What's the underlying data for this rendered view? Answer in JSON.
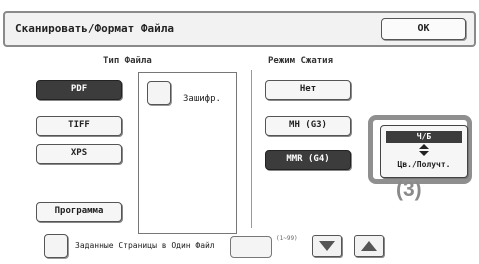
{
  "header": {
    "title": "Сканировать/Формат Файла",
    "ok_label": "OK"
  },
  "file_type": {
    "label": "Тип Файла",
    "options": [
      {
        "label": "PDF",
        "selected": true
      },
      {
        "label": "TIFF",
        "selected": false
      },
      {
        "label": "XPS",
        "selected": false
      }
    ],
    "program_label": "Программа",
    "encrypt_label": "Зашифр."
  },
  "compression": {
    "label": "Режим Сжатия",
    "options": [
      {
        "label": "Нет",
        "selected": false
      },
      {
        "label": "MH (G3)",
        "selected": false
      },
      {
        "label": "MMR (G4)",
        "selected": true
      }
    ]
  },
  "color_mode": {
    "top_label": "Ч/Б",
    "bottom_label": "Цв./Получт.",
    "toggle_icon": "up-down-arrows-icon",
    "callout": "(3)"
  },
  "pages_per_file": {
    "label": "Заданные Страницы в Один Файл",
    "value": "",
    "range_hint": "(1~99)",
    "down_icon": "triangle-down-icon",
    "up_icon": "triangle-up-icon"
  },
  "colors": {
    "selected_bg": "#3c3c3c",
    "highlight_border": "#8f8f8f"
  }
}
